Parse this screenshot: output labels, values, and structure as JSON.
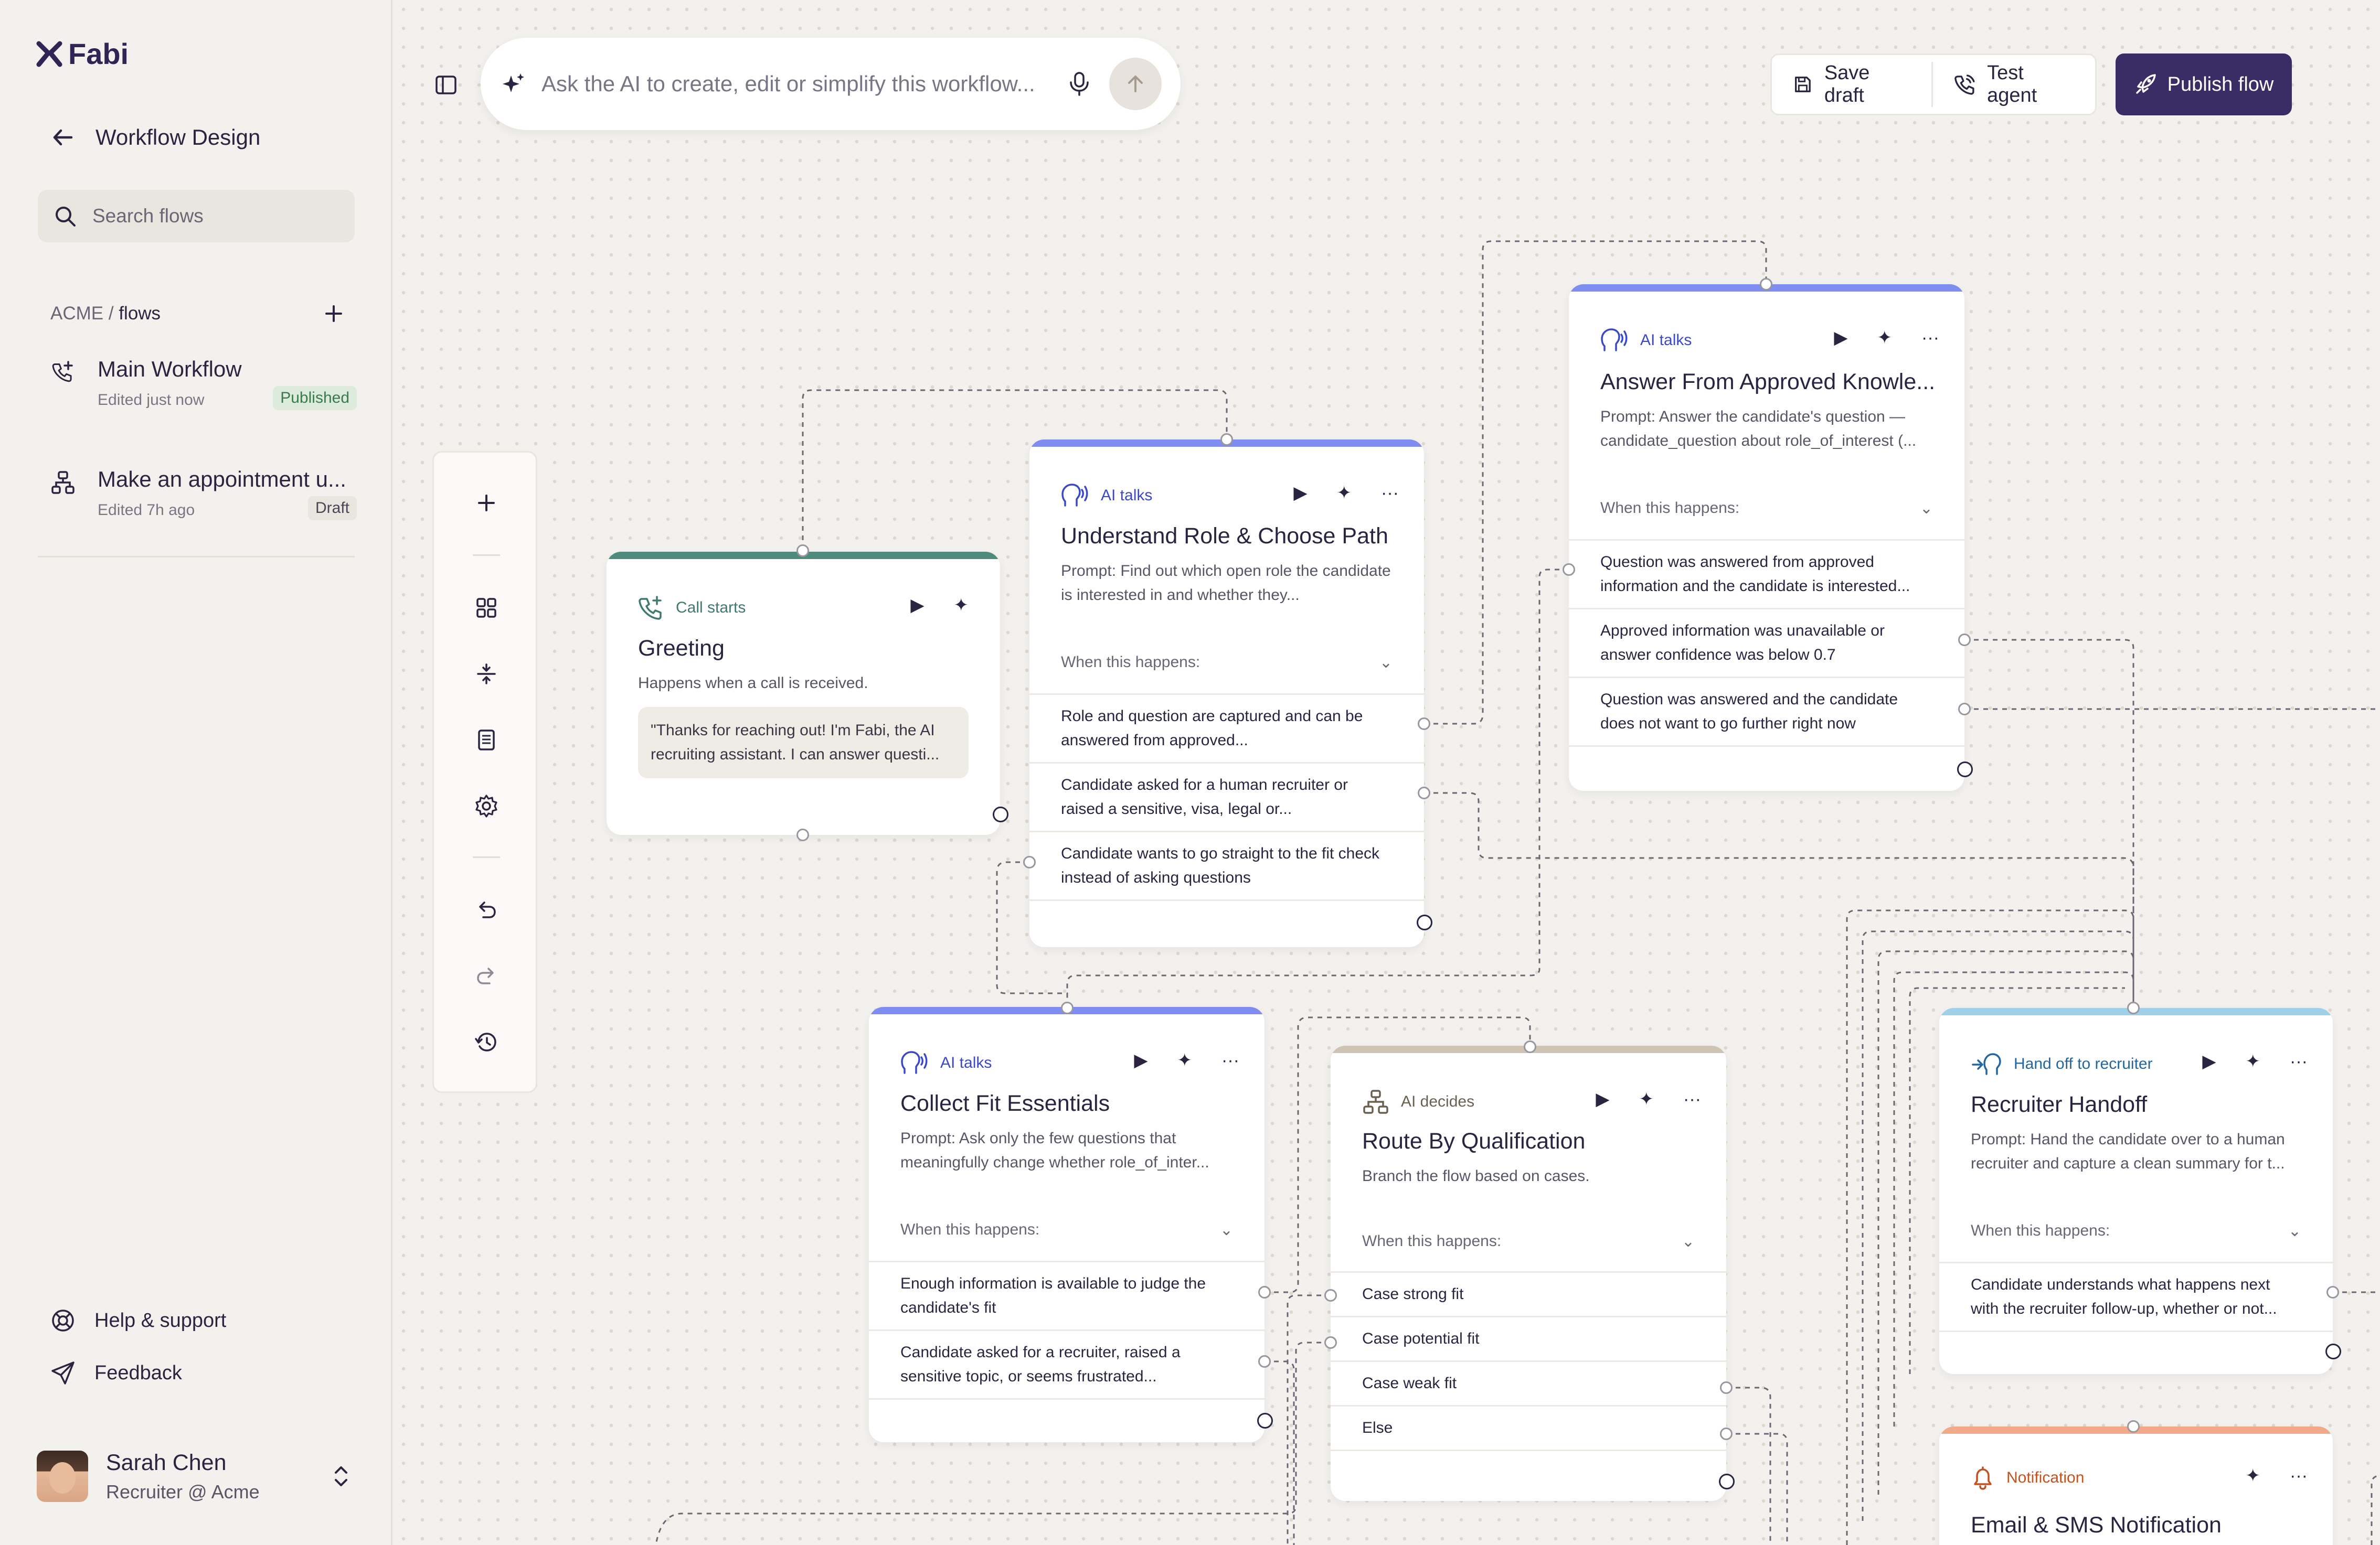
{
  "sidebar": {
    "logo": "Fabi",
    "back_title": "Workflow Design",
    "search_placeholder": "Search flows",
    "crumb_org": "ACME",
    "crumb_sep": " / ",
    "crumb_page": "flows",
    "flows": [
      {
        "name": "Main Workflow",
        "meta": "Edited just now",
        "badge": "Published"
      },
      {
        "name": "Make an appointment u...",
        "meta": "Edited 7h ago",
        "badge": "Draft"
      }
    ],
    "help": "Help & support",
    "feedback": "Feedback",
    "user": {
      "name": "Sarah Chen",
      "role": "Recruiter @ Acme"
    }
  },
  "topbar": {
    "prompt_placeholder": "Ask the AI to create, edit or simplify this workflow...",
    "save_draft": "Save draft",
    "test_agent": "Test agent",
    "publish": "Publish flow"
  },
  "nodes": {
    "greeting": {
      "kind": "Call starts",
      "title": "Greeting",
      "desc": "Happens when a call is received.",
      "quote": "\"Thanks for reaching out! I'm Fabi, the AI recruiting assistant. I can answer questi..."
    },
    "understand": {
      "kind": "AI talks",
      "title": "Understand Role & Choose Path",
      "desc": "Prompt: Find out which open role the candidate is interested in and whether they...",
      "when": "When this happens:",
      "cases": [
        "Role and question are captured and can be answered from approved...",
        "Candidate asked for a human recruiter or raised a sensitive, visa, legal or...",
        "Candidate wants to go straight to the fit check instead of asking questions"
      ]
    },
    "answer": {
      "kind": "AI talks",
      "title": "Answer From Approved Knowle...",
      "desc": "Prompt: Answer the candidate's question — candidate_question about role_of_interest (...",
      "when": "When this happens:",
      "cases": [
        "Question was answered from approved information and the candidate is interested...",
        "Approved information was unavailable or answer confidence was below 0.7",
        "Question was answered and the candidate does not want to go further right now"
      ]
    },
    "collect": {
      "kind": "AI talks",
      "title": "Collect Fit Essentials",
      "desc": "Prompt: Ask only the few questions that meaningfully change whether role_of_inter...",
      "when": "When this happens:",
      "cases": [
        "Enough information is available to judge the candidate's fit",
        "Candidate asked for a recruiter, raised a sensitive topic, or seems frustrated..."
      ]
    },
    "route": {
      "kind": "AI decides",
      "title": "Route By Qualification",
      "desc": "Branch the flow based on cases.",
      "when": "When this happens:",
      "cases": [
        "Case strong fit",
        "Case potential fit",
        "Case weak fit",
        "Else"
      ]
    },
    "handoff": {
      "kind": "Hand off to recruiter",
      "title": "Recruiter Handoff",
      "desc": "Prompt: Hand the candidate over to a human recruiter and capture a clean summary for t...",
      "when": "When this happens:",
      "cases": [
        "Candidate understands what happens next with the recruiter follow-up, whether or not..."
      ]
    },
    "notify": {
      "kind": "Notification",
      "title": "Email & SMS Notification"
    }
  },
  "colors": {
    "brand": "#3a2c64",
    "ai_talks_bar": "#7f8cf0",
    "call_starts_bar": "#4f8a7c",
    "ai_decides_bar": "#cfc4b3",
    "handoff_bar": "#9fd0ea",
    "notification_bar": "#f2a98a"
  }
}
